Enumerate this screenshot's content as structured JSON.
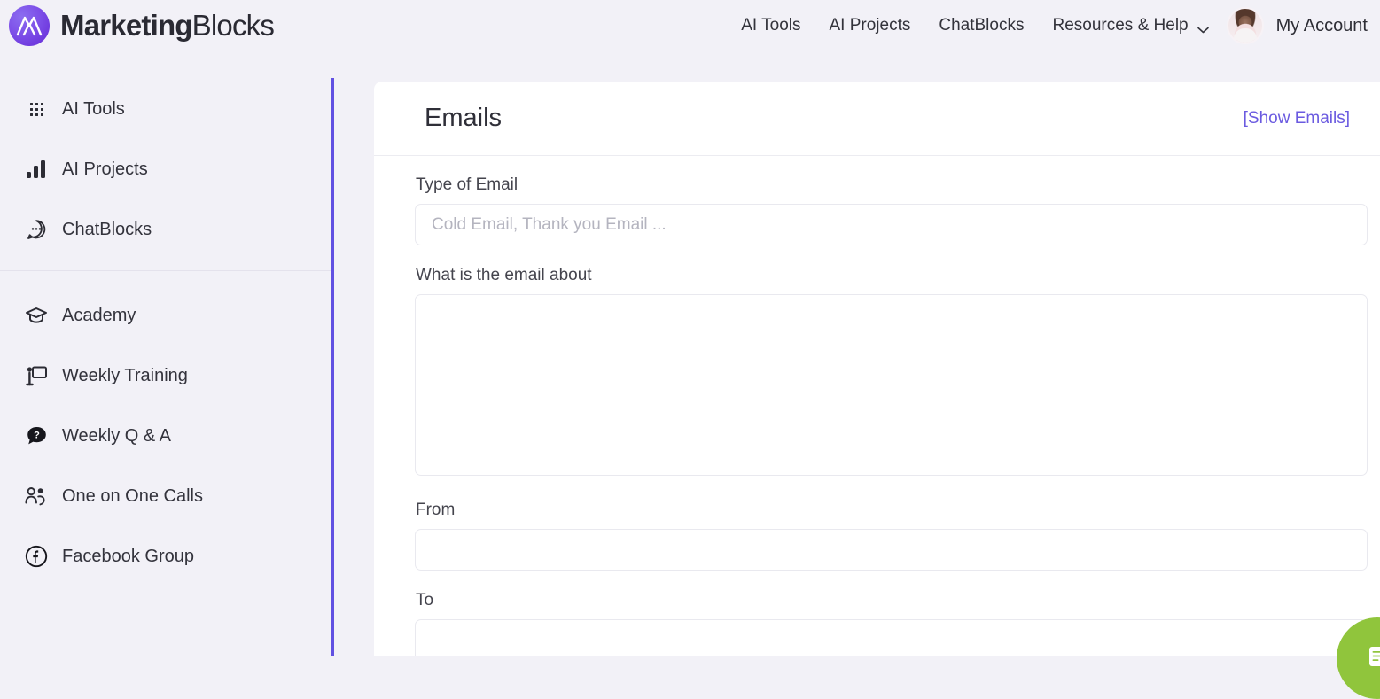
{
  "brand": {
    "name_bold": "Marketing",
    "name_light": "Blocks",
    "logo_icon": "marketingblocks-mountain-logo"
  },
  "topnav": {
    "items": [
      {
        "label": "AI Tools",
        "icon": "none"
      },
      {
        "label": "AI Projects",
        "icon": "none"
      },
      {
        "label": "ChatBlocks",
        "icon": "none"
      }
    ],
    "dropdown": {
      "label": "Resources & Help",
      "icon": "chevron-down-icon"
    },
    "account": {
      "label": "My Account",
      "avatar_icon": "user-avatar-photo"
    }
  },
  "sidebar": {
    "primary": [
      {
        "label": "AI Tools",
        "icon": "grid-apps-icon"
      },
      {
        "label": "AI Projects",
        "icon": "bar-chart-icon"
      },
      {
        "label": "ChatBlocks",
        "icon": "chat-bubble-dots-icon"
      }
    ],
    "secondary": [
      {
        "label": "Academy",
        "icon": "graduation-cap-icon"
      },
      {
        "label": "Weekly Training",
        "icon": "presentation-board-icon"
      },
      {
        "label": "Weekly Q & A",
        "icon": "question-bubble-icon"
      },
      {
        "label": "One on One Calls",
        "icon": "users-call-icon"
      },
      {
        "label": "Facebook Group",
        "icon": "facebook-icon"
      }
    ]
  },
  "card": {
    "title": "Emails",
    "show_link": "[Show Emails]",
    "fields": [
      {
        "label": "Type of Email",
        "placeholder": "Cold Email, Thank you Email ...",
        "value": "",
        "type": "input"
      },
      {
        "label": "What is the email about",
        "placeholder": "",
        "value": "",
        "type": "textarea"
      },
      {
        "label": "From",
        "placeholder": "",
        "value": "",
        "type": "input"
      },
      {
        "label": "To",
        "placeholder": "",
        "value": "",
        "type": "input"
      }
    ]
  },
  "chat_widget": {
    "icon": "chat-support-icon",
    "color": "#90c53c"
  },
  "colors": {
    "page_bg": "#f2f1f7",
    "accent_purple": "#6151e2",
    "link_purple": "#6a5ae0",
    "text_dark": "#2f2f38",
    "card_bg": "#ffffff",
    "widget_green": "#90c53c"
  }
}
